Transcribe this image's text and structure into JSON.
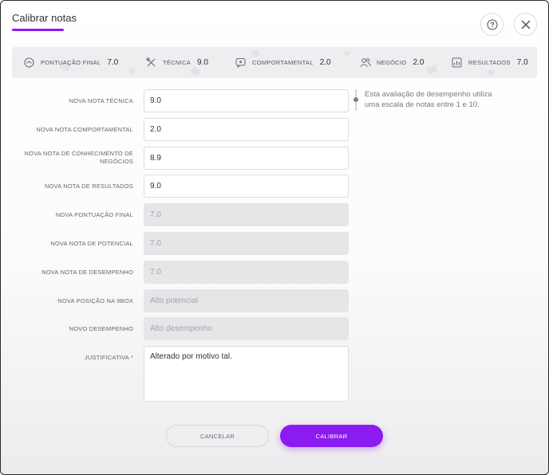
{
  "dialog": {
    "title": "Calibrar notas",
    "accent_color": "#8b1bf0"
  },
  "header_actions": {
    "help_icon": "question-circle-icon",
    "close_icon": "close-x-icon"
  },
  "scores": [
    {
      "icon": "gauge-icon",
      "label": "PONTUAÇÃO FINAL",
      "value": "7.0"
    },
    {
      "icon": "tools-icon",
      "label": "TÉCNICA",
      "value": "9.0"
    },
    {
      "icon": "chat-heart-icon",
      "label": "COMPORTAMENTAL",
      "value": "2.0"
    },
    {
      "icon": "users-icon",
      "label": "NEGÓCIO",
      "value": "2.0"
    },
    {
      "icon": "chart-badge-icon",
      "label": "RESULTADOS",
      "value": "7.0"
    }
  ],
  "hint": "Esta avaliação de desempenho utiliza uma escala de notas entre 1 e 10.",
  "fields": [
    {
      "label": "NOVA NOTA TÉCNICA",
      "value": "9.0",
      "disabled": false
    },
    {
      "label": "NOVA NOTA COMPORTAMENTAL",
      "value": "2.0",
      "disabled": false
    },
    {
      "label": "NOVA NOTA DE CONHECIMENTO DE NEGÓCIOS",
      "value": "8.9",
      "disabled": false
    },
    {
      "label": "NOVA NOTA DE RESULTADOS",
      "value": "9.0",
      "disabled": false
    },
    {
      "label": "NOVA PONTUAÇÃO FINAL",
      "value": "7.0",
      "disabled": true
    },
    {
      "label": "NOVA NOTA DE POTENCIAL",
      "value": "7.0",
      "disabled": true
    },
    {
      "label": "NOVA NOTA DE DESEMPENHO",
      "value": "7.0",
      "disabled": true
    },
    {
      "label": "NOVA POSIÇÃO NA 9BOX",
      "value": "Alto potencial",
      "disabled": true
    },
    {
      "label": "NOVO DESEMPENHO",
      "value": "Alto desempenho",
      "disabled": true
    }
  ],
  "justification": {
    "label": "JUSTIFICATIVA",
    "required_mark": "*",
    "value": "Alterado por motivo tal."
  },
  "actions": {
    "cancel_label": "CANCELAR",
    "submit_label": "CALIBRAR"
  }
}
